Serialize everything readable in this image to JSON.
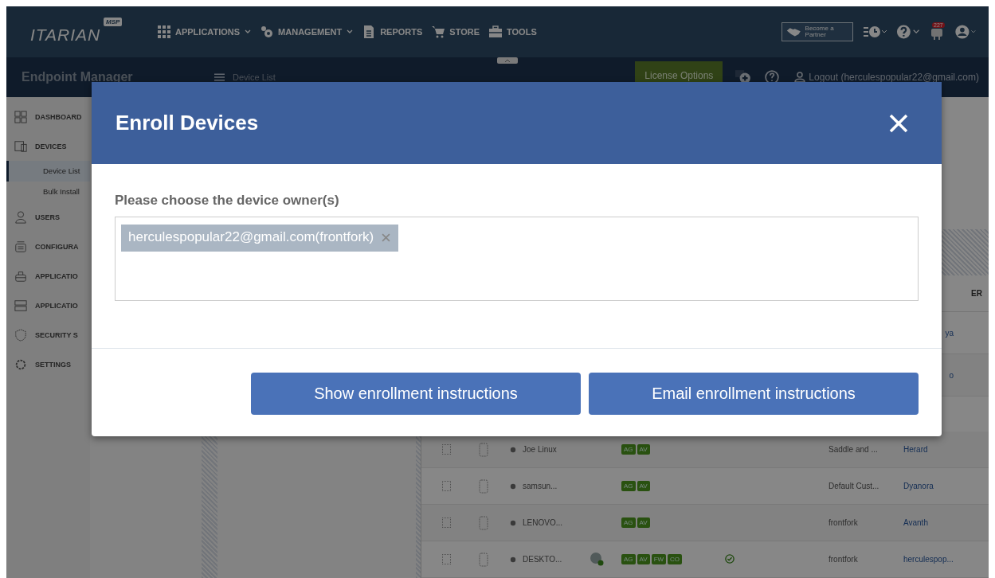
{
  "topbar": {
    "logo": "ITARIAN",
    "logo_badge": "MSP",
    "nav": [
      {
        "label": "APPLICATIONS",
        "dropdown": true
      },
      {
        "label": "MANAGEMENT",
        "dropdown": true
      },
      {
        "label": "REPORTS",
        "dropdown": false
      },
      {
        "label": "STORE",
        "dropdown": false
      },
      {
        "label": "TOOLS",
        "dropdown": false
      }
    ],
    "partner": "Become a Partner",
    "notifications": "227"
  },
  "subbar": {
    "title": "Endpoint Manager",
    "breadcrumb": "Device List",
    "license_button": "License Options",
    "logout": "Logout (herculespopular22@gmail.com)"
  },
  "sidebar": {
    "items": [
      {
        "label": "DASHBOARD"
      },
      {
        "label": "DEVICES",
        "children": [
          {
            "label": "Device List",
            "selected": true
          },
          {
            "label": "Bulk Install",
            "selected": false
          }
        ]
      },
      {
        "label": "USERS"
      },
      {
        "label": "CONFIGURA"
      },
      {
        "label": "APPLICATIO"
      },
      {
        "label": "APPLICATIO"
      },
      {
        "label": "SECURITY S"
      },
      {
        "label": "SETTINGS"
      }
    ]
  },
  "table": {
    "owner_heading": "ER",
    "rows": [
      {
        "kind": "partial",
        "owner": "ya"
      },
      {
        "kind": "partial",
        "owner": "o"
      },
      {
        "kind": "device",
        "checked": false,
        "name": "Joe Linux",
        "tags": [
          "AG",
          "AV"
        ],
        "status_ok": false,
        "customer": "Saddle and ...",
        "owner": "Herard"
      },
      {
        "kind": "device",
        "checked": false,
        "name": "samsun...",
        "tags": [
          "AG",
          "AV"
        ],
        "status_ok": false,
        "customer": "Default Cust...",
        "owner": "Dyanora"
      },
      {
        "kind": "device",
        "checked": false,
        "name": "LENOVO...",
        "tags": [
          "AG",
          "AV"
        ],
        "status_ok": false,
        "customer": "frontfork",
        "owner": "Avanth"
      },
      {
        "kind": "device",
        "checked": false,
        "name": "DESKTO...",
        "tags": [
          "AG",
          "AV",
          "FW",
          "CO"
        ],
        "status_ok": true,
        "customer": "frontfork",
        "owner": "herculespop..."
      }
    ]
  },
  "dialog": {
    "title": "Enroll Devices",
    "label": "Please choose the device owner(s)",
    "owners": [
      "herculespopular22@gmail.com(frontfork)"
    ],
    "buttons": [
      "Show enrollment instructions",
      "Email enrollment instructions"
    ]
  }
}
